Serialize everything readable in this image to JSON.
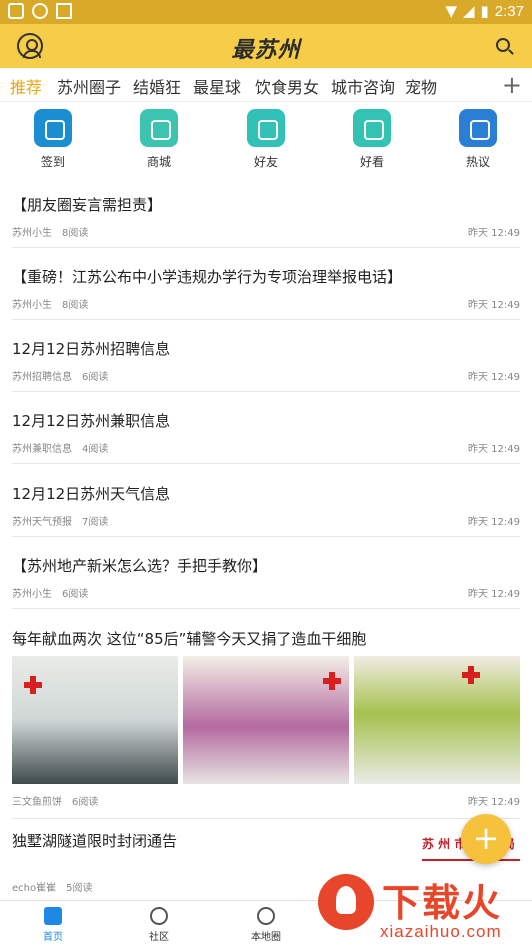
{
  "status_bar": {
    "time": "2:37"
  },
  "app_bar": {
    "logo": "最苏州"
  },
  "tabs": [
    {
      "label": "推荐",
      "active": true
    },
    {
      "label": "苏州圈子",
      "active": false
    },
    {
      "label": "结婚狂",
      "active": false
    },
    {
      "label": "最星球",
      "active": false
    },
    {
      "label": "饮食男女",
      "active": false
    },
    {
      "label": "城市咨询",
      "active": false
    },
    {
      "label": "宠物",
      "active": false
    }
  ],
  "tabs_add": "+",
  "quick_actions": [
    {
      "label": "签到",
      "icon": "tea-cup-icon"
    },
    {
      "label": "商城",
      "icon": "store-icon"
    },
    {
      "label": "好友",
      "icon": "friend-icon"
    },
    {
      "label": "好看",
      "icon": "board-icon"
    },
    {
      "label": "热议",
      "icon": "clipboard-icon"
    }
  ],
  "articles": [
    {
      "title": "【朋友圈妄言需担责】",
      "author": "苏州小生",
      "views": "8阅读",
      "time": "昨天 12:49"
    },
    {
      "title": "【重磅！江苏公布中小学违规办学行为专项治理举报电话】",
      "author": "苏州小生",
      "views": "8阅读",
      "time": "昨天 12:49"
    },
    {
      "title": "12月12日苏州招聘信息",
      "author": "苏州招聘信息",
      "views": "6阅读",
      "time": "昨天 12:49"
    },
    {
      "title": "12月12日苏州兼职信息",
      "author": "苏州兼职信息",
      "views": "4阅读",
      "time": "昨天 12:49"
    },
    {
      "title": "12月12日苏州天气信息",
      "author": "苏州天气预报",
      "views": "7阅读",
      "time": "昨天 12:49"
    },
    {
      "title": "【苏州地产新米怎么选？手把手教你】",
      "author": "苏州小生",
      "views": "6阅读",
      "time": "昨天 12:49"
    },
    {
      "title": "每年献血两次 这位“85后”辅警今天又捐了造血干细胞",
      "author": "三文鱼煎饼",
      "views": "6阅读",
      "time": "昨天 12:49"
    },
    {
      "title": "独墅湖隧道限时封闭通告",
      "author": "echo崔崔",
      "views": "5阅读",
      "time": ""
    }
  ],
  "thumb_text": "苏 州 市 公 安 局",
  "fab": "+",
  "bottom_nav": [
    {
      "label": "首页",
      "active": true
    },
    {
      "label": "社区",
      "active": false
    },
    {
      "label": "本地圈",
      "active": false
    }
  ],
  "watermark": {
    "text": "下载火",
    "url": "xiazaihuo.com"
  },
  "colors": {
    "accent": "#e6a817",
    "appbar": "#f6cd48",
    "fab": "#f6c13b",
    "nav_active": "#1f88e5"
  }
}
